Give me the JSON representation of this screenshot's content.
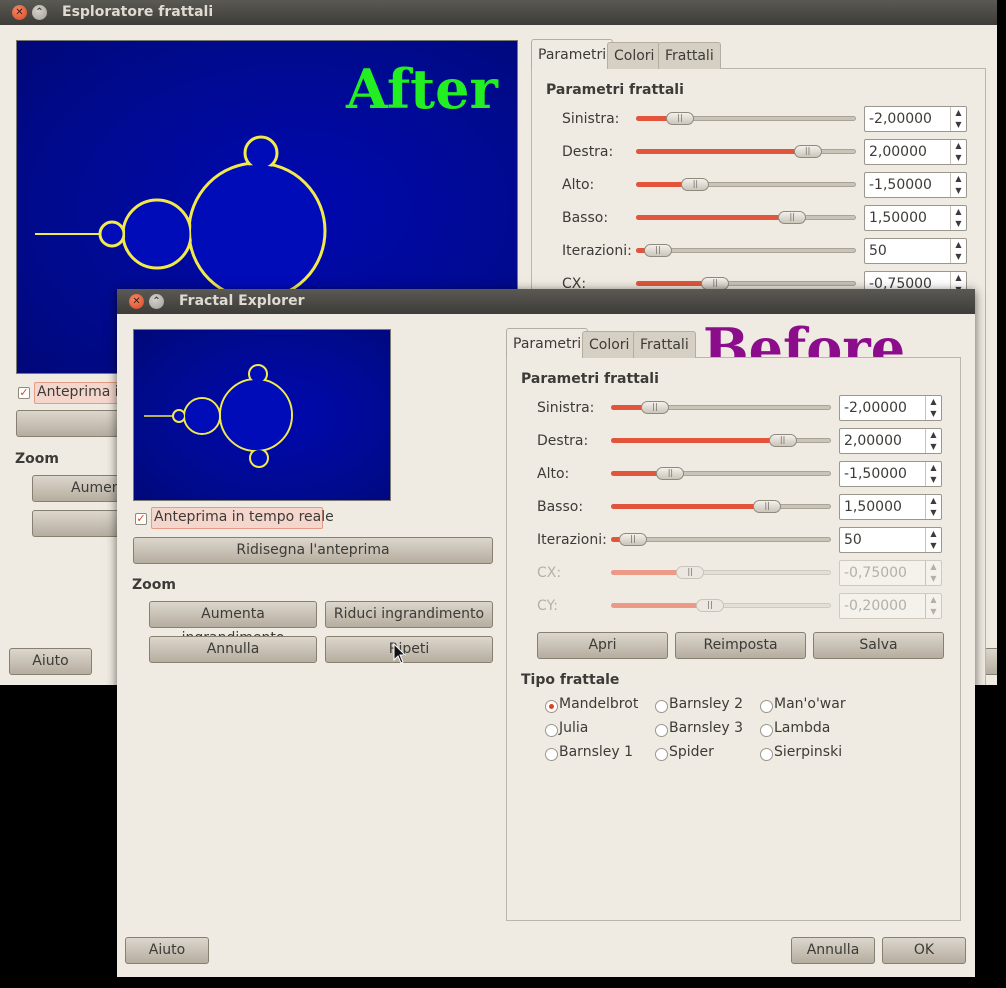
{
  "back": {
    "title": "Esploratore frattali",
    "overlay": "After",
    "overlay_color": "#22ee22",
    "tabs": [
      "Parametri",
      "Colori",
      "Frattali"
    ],
    "section": "Parametri frattali",
    "realtime": "Anteprima in tempo reale",
    "realtime_visible": "Anteprima ir",
    "zoom": "Zoom",
    "zoom_in_visible": "Aumen",
    "help": "Aiuto",
    "params": [
      {
        "label": "Sinistra:",
        "value": "-2,00000",
        "pos": 0.2
      },
      {
        "label": "Destra:",
        "value": "2,00000",
        "pos": 0.78
      },
      {
        "label": "Alto:",
        "value": "-1,50000",
        "pos": 0.27
      },
      {
        "label": "Basso:",
        "value": "1,50000",
        "pos": 0.71
      },
      {
        "label": "Iterazioni:",
        "value": "50",
        "pos": 0.1
      },
      {
        "label": "CX:",
        "value": "-0,75000",
        "pos": 0.36
      }
    ]
  },
  "front": {
    "title": "Fractal Explorer",
    "overlay": "Before",
    "overlay_color": "#8b0d8b",
    "tabs": [
      "Parametri",
      "Colori",
      "Frattali"
    ],
    "section": "Parametri frattali",
    "realtime": "Anteprima in tempo reale",
    "redraw": "Ridisegna l'anteprima",
    "zoom": "Zoom",
    "zoom_in": "Aumenta ingrandimento",
    "zoom_out": "Riduci ingrandimento",
    "undo": "Annulla",
    "redo": "Ripeti",
    "params": [
      {
        "label": "Sinistra:",
        "value": "-2,00000",
        "pos": 0.2,
        "disabled": false
      },
      {
        "label": "Destra:",
        "value": "2,00000",
        "pos": 0.78,
        "disabled": false
      },
      {
        "label": "Alto:",
        "value": "-1,50000",
        "pos": 0.27,
        "disabled": false
      },
      {
        "label": "Basso:",
        "value": "1,50000",
        "pos": 0.71,
        "disabled": false
      },
      {
        "label": "Iterazioni:",
        "value": "50",
        "pos": 0.1,
        "disabled": false
      },
      {
        "label": "CX:",
        "value": "-0,75000",
        "pos": 0.36,
        "disabled": true
      },
      {
        "label": "CY:",
        "value": "-0,20000",
        "pos": 0.45,
        "disabled": true
      }
    ],
    "open": "Apri",
    "reset": "Reimposta",
    "save": "Salva",
    "type_title": "Tipo frattale",
    "types": [
      [
        "Mandelbrot",
        "Barnsley 2",
        "Man'o'war"
      ],
      [
        "Julia",
        "Barnsley 3",
        "Lambda"
      ],
      [
        "Barnsley 1",
        "Spider",
        "Sierpinski"
      ]
    ],
    "help": "Aiuto",
    "cancel": "Annulla",
    "ok": "OK"
  }
}
